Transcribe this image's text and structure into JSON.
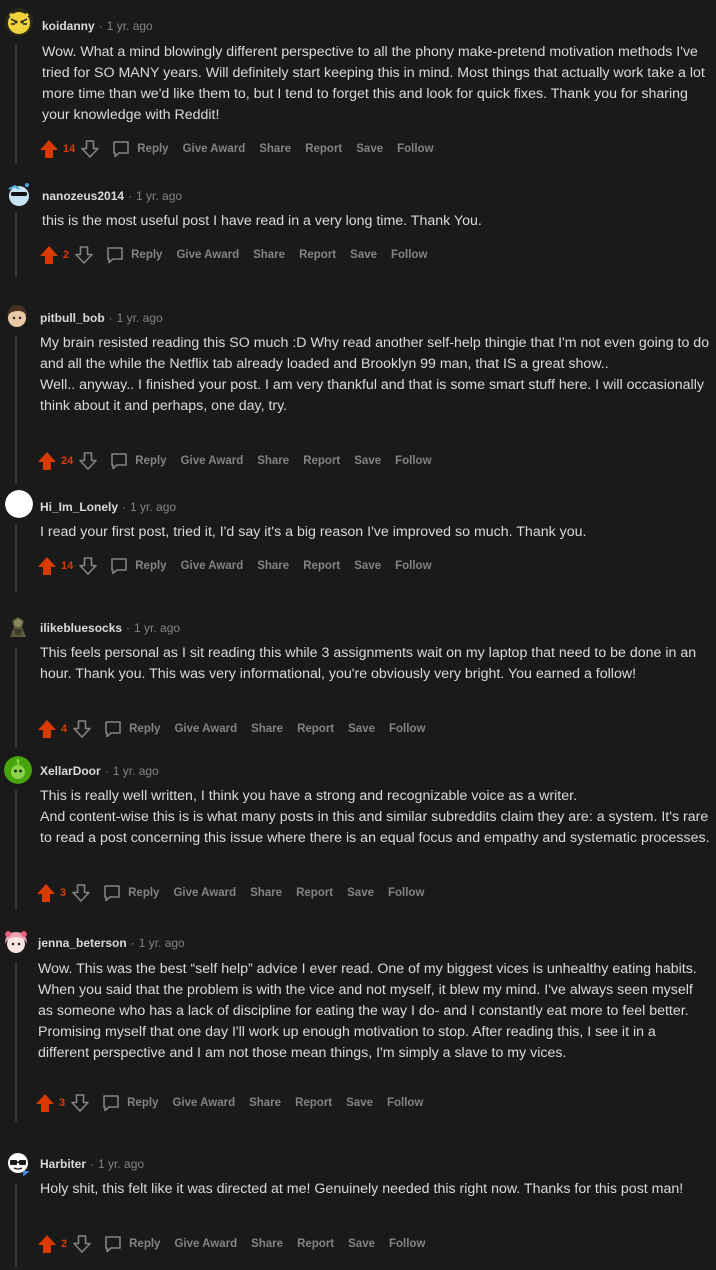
{
  "colors": {
    "background": "#1a1a1b",
    "upvote": "#d93a00",
    "muted": "#818384",
    "text": "#d7dadc"
  },
  "actions": {
    "reply": "Reply",
    "give_award": "Give Award",
    "share": "Share",
    "report": "Report",
    "save": "Save",
    "follow": "Follow"
  },
  "comments": [
    {
      "author": "koidanny",
      "time": "1 yr. ago",
      "score": "14",
      "avatar_icon": "tiger-avatar-icon",
      "paragraphs": [
        "Wow. What a mind blowingly different perspective to all the phony make-pretend motivation methods I've tried for SO MANY years. Will definitely start keeping this in mind. Most things that actually work take a lot more time than we'd like them to, but I tend to forget this and look for quick fixes. Thank you for sharing your knowledge with Reddit!"
      ]
    },
    {
      "author": "nanozeus2014",
      "time": "1 yr. ago",
      "score": "2",
      "avatar_icon": "snoo-sunglasses-avatar-icon",
      "paragraphs": [
        "this is the most useful post I have read in a very long time. Thank You."
      ]
    },
    {
      "author": "pitbull_bob",
      "time": "1 yr. ago",
      "score": "24",
      "avatar_icon": "brown-hair-avatar-icon",
      "paragraphs": [
        "My brain resisted reading this SO much :D Why read another self-help thingie that I'm not even going to do and all the while the Netflix tab already loaded and Brooklyn 99 man, that IS a great show..",
        "Well.. anyway.. I finished your post. I am very thankful and that is some smart stuff here. I will occasionally think about it and perhaps, one day, try."
      ]
    },
    {
      "author": "Hi_Im_Lonely",
      "time": "1 yr. ago",
      "score": "14",
      "avatar_icon": "blank-avatar-icon",
      "paragraphs": [
        "I read your first post, tried it, I'd say it's a big reason I've improved so much. Thank you."
      ]
    },
    {
      "author": "ilikebluesocks",
      "time": "1 yr. ago",
      "score": "4",
      "avatar_icon": "soldier-avatar-icon",
      "paragraphs": [
        "This feels personal as I sit reading this while 3 assignments wait on my laptop that need to be done in an hour. Thank you. This was very informational, you're obviously very bright. You earned a follow!"
      ]
    },
    {
      "author": "XellarDoor",
      "time": "1 yr. ago",
      "score": "3",
      "avatar_icon": "green-alien-avatar-icon",
      "paragraphs": [
        "This is really well written, I think you have a strong and recognizable voice as a writer.",
        "And content-wise this is is what many posts in this and similar subreddits claim they are: a system. It's rare to read a post concerning this issue where there is an equal focus and empathy and systematic processes."
      ]
    },
    {
      "author": "jenna_beterson",
      "time": "1 yr. ago",
      "score": "3",
      "avatar_icon": "pink-hair-avatar-icon",
      "paragraphs": [
        "Wow. This was the best “self help” advice I ever read. One of my biggest vices is unhealthy eating habits. When you said that the problem is with the vice and not myself, it blew my mind. I've always seen myself as someone who has a lack of discipline for eating the way I do- and I constantly eat more to feel better. Promising myself that one day I'll work up enough motivation to stop. After reading this, I see it in a different perspective and I am not those mean things, I'm simply a slave to my vices."
      ]
    },
    {
      "author": "Harbiter",
      "time": "1 yr. ago",
      "score": "2",
      "avatar_icon": "glasses-avatar-icon",
      "paragraphs": [
        "Holy shit, this felt like it was directed at me! Genuinely needed this right now. Thanks for this post man!"
      ]
    }
  ]
}
